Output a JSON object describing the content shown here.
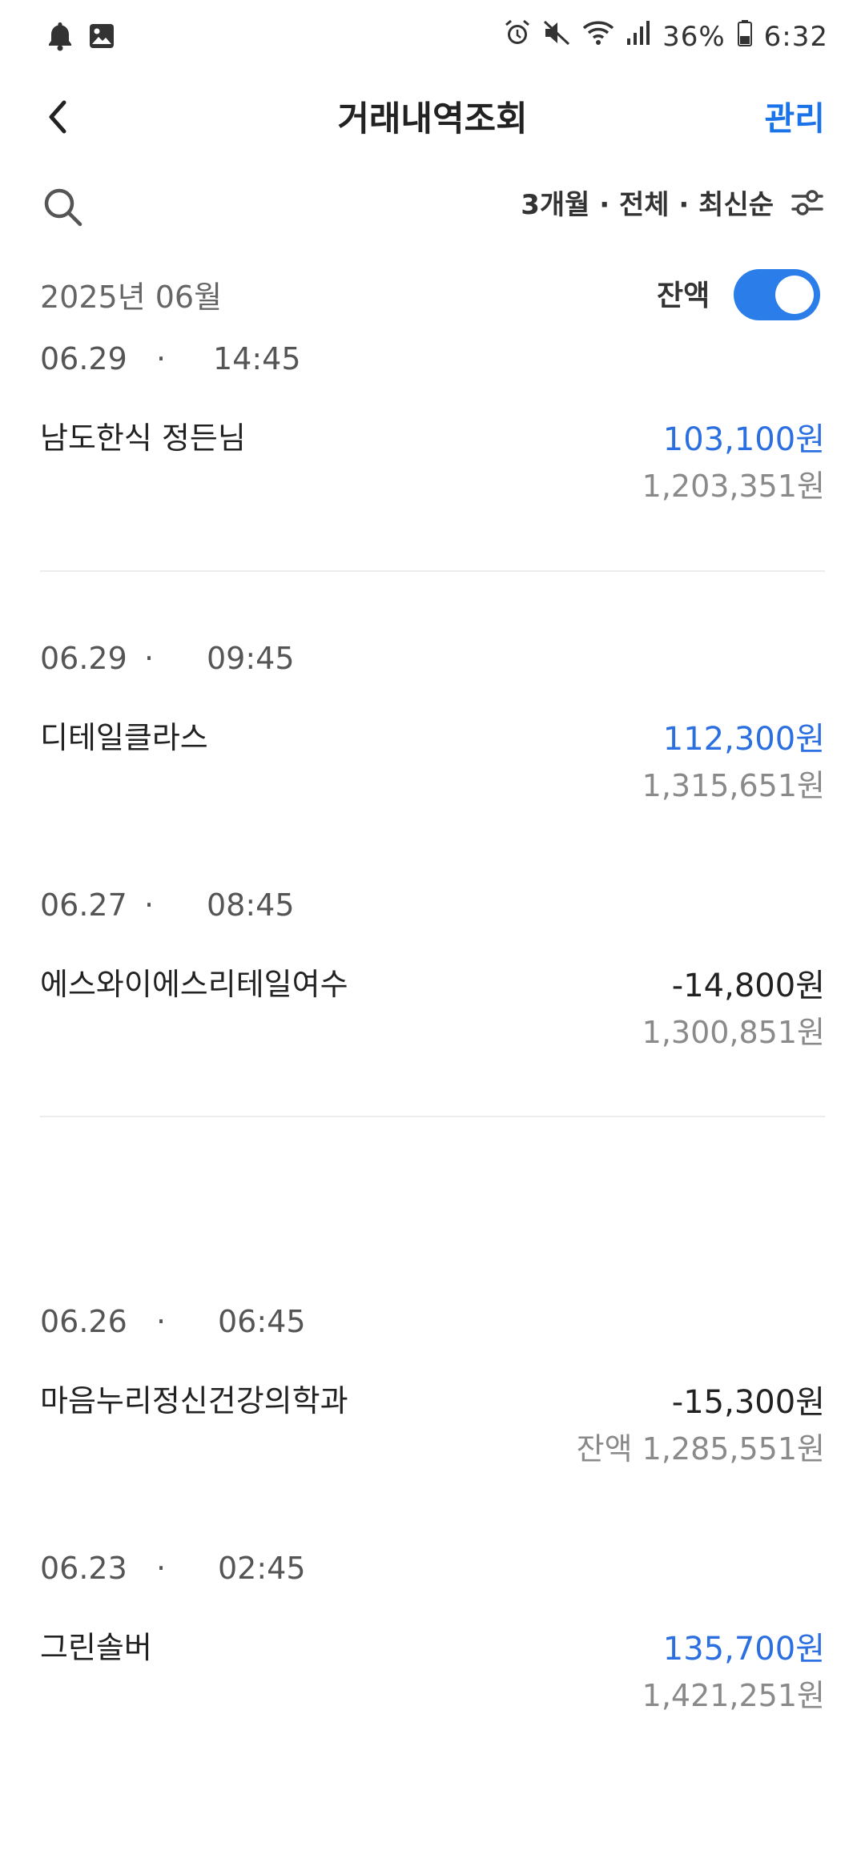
{
  "status_bar": {
    "battery": "36%",
    "time": "6:32",
    "icons_left": [
      "bell-icon",
      "image-icon"
    ],
    "icons_right": [
      "alarm-icon",
      "mute-icon",
      "wifi-icon",
      "signal-icon",
      "battery-icon"
    ]
  },
  "header": {
    "title": "거래내역조회",
    "manage_label": "관리"
  },
  "filter": {
    "label": "3개월 · 전체 · 최신순"
  },
  "month_section": {
    "month_label": "2025년 06월",
    "balance_toggle_label": "잔액",
    "balance_toggle_on": true
  },
  "transactions": [
    {
      "date": "06.29",
      "dot": "·",
      "time": "14:45",
      "name": "남도한식 정든님",
      "amount": "103,100원",
      "balance": "1,203,351원",
      "type": "deposit"
    },
    {
      "date": "06.29",
      "dot": "·",
      "time": "09:45",
      "name": "디테일클라스",
      "amount": "112,300원",
      "balance": "1,315,651원",
      "type": "deposit"
    },
    {
      "date": "06.27",
      "dot": "·",
      "time": "08:45",
      "name": "에스와이에스리테일여수",
      "amount": "-14,800원",
      "balance": "1,300,851원",
      "type": "withdrawal"
    },
    {
      "date": "06.26",
      "dot": "·",
      "time": "06:45",
      "name": "마음누리정신건강의학과",
      "amount": "-15,300원",
      "balance": "잔액 1,285,551원",
      "type": "withdrawal"
    },
    {
      "date": "06.23",
      "dot": "·",
      "time": "02:45",
      "name": "그린솔버",
      "amount": "135,700원",
      "balance": "1,421,251원",
      "type": "deposit"
    }
  ],
  "colors": {
    "accent": "#1a73e8",
    "deposit": "#2b6fe0",
    "toggle": "#2b7de9"
  }
}
